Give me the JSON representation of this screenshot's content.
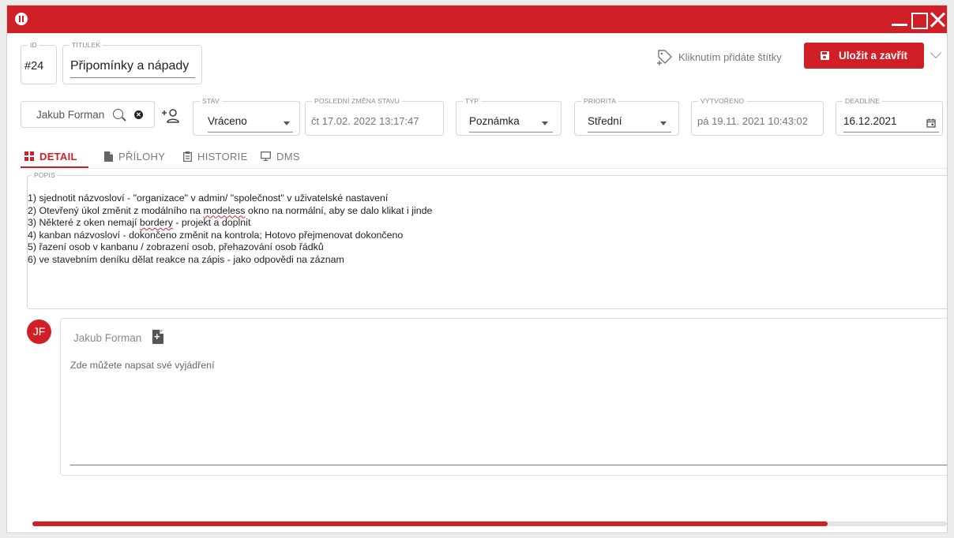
{
  "colors": {
    "accent": "#d11f27",
    "surface": "#ffffff",
    "muted_text": "#8a8a8a"
  },
  "icons": [
    "app-logo-icon",
    "minimize-icon",
    "maximize-icon",
    "close-icon",
    "tag-add-icon",
    "floppy-icon",
    "chevron-down-icon",
    "search-icon",
    "clear-icon",
    "add-user-icon",
    "grid-icon",
    "file-icon",
    "clipboard-icon",
    "monitor-icon",
    "calendar-icon",
    "document-add-icon"
  ],
  "header": {
    "id_label": "ID",
    "id_value": "#24",
    "title_label": "TITULEK",
    "title_value": "Připomínky a nápady",
    "tag_hint": "Kliknutím přidáte štítky",
    "save_label": "Uložit a zavřít"
  },
  "fields": {
    "assignee": "Jakub Forman",
    "stav_label": "STAV",
    "stav_value": "Vráceno",
    "last_change_label": "POSLEDNÍ ZMĚNA STAVU",
    "last_change_value": "čt 17.02. 2022 13:17:47",
    "typ_label": "TYP",
    "typ_value": "Poznámka",
    "priorita_label": "PRIORITA",
    "priorita_value": "Střední",
    "vytvoreno_label": "VYTVOŘENO",
    "vytvoreno_value": "pá 19.11. 2021 10:43:02",
    "deadline_label": "DEADLINE",
    "deadline_value": "16.12.2021"
  },
  "tabs": [
    {
      "label": "DETAIL",
      "active": true
    },
    {
      "label": "PŘÍLOHY",
      "active": false
    },
    {
      "label": "HISTORIE",
      "active": false
    },
    {
      "label": "DMS",
      "active": false
    }
  ],
  "popis": {
    "label": "POPIS",
    "lines": [
      "1) sjednotit názvosloví  - \"organizace\" v admin/ \"společnost\" v uživatelské nastavení",
      "2) Otevřený úkol změnit z modálního na modeless okno na normální, aby se dalo klikat i jinde",
      "3) Některé z oken nemají bordery - projekt a doplnit",
      "4) kanban názvosloví - dokončeno změnit na kontrola; Hotovo přejmenovat dokončeno",
      "5) řazení osob v kanbanu / zobrazení osob, přehazování osob řádků",
      "6) ve stavebním deníku dělat reakce na zápis - jako odpovědi na záznam"
    ]
  },
  "comment": {
    "avatar_initials": "JF",
    "author": "Jakub Forman",
    "placeholder": "Zde můžete napsat své vyjádření"
  },
  "scroll": {
    "position_fraction": 0.87
  }
}
